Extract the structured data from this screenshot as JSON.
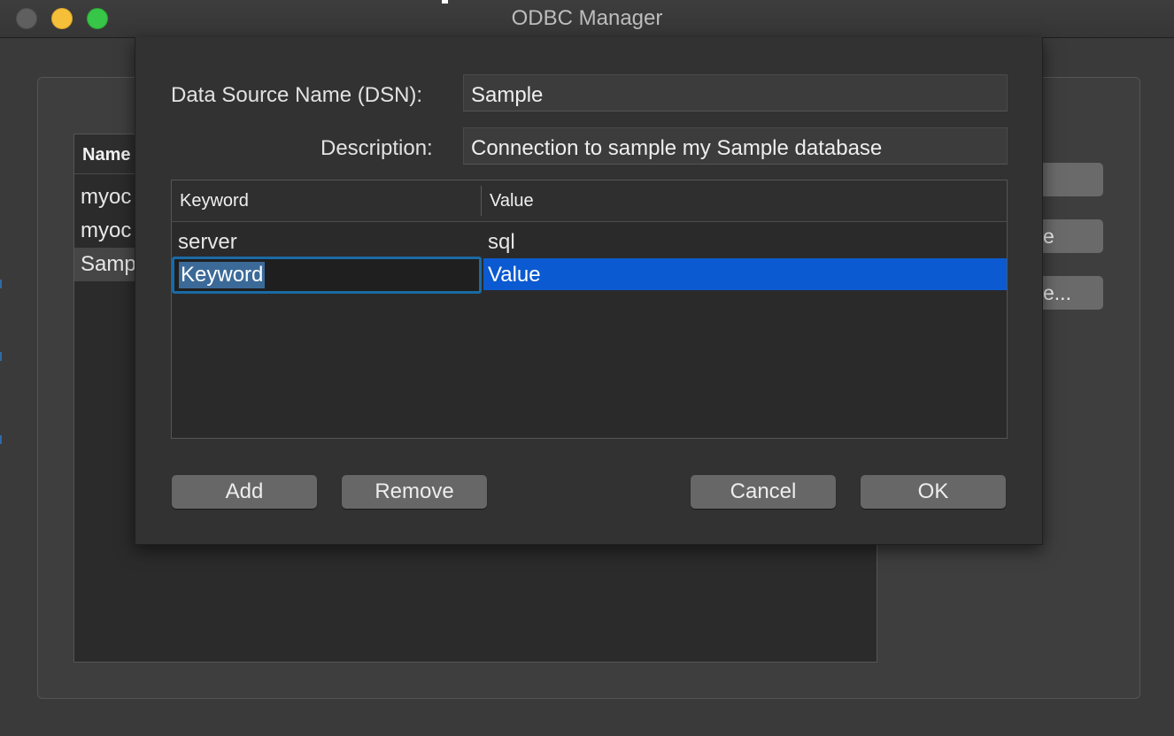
{
  "window": {
    "title": "ODBC Manager"
  },
  "dsn_list": {
    "header": "Name",
    "rows": [
      "myoc",
      "myoc",
      "Samp"
    ],
    "selected_index": 2
  },
  "side_buttons": [
    "",
    "e",
    "e..."
  ],
  "dialog": {
    "dsn_label": "Data Source Name (DSN):",
    "dsn_value": "Sample",
    "description_label": "Description:",
    "description_value": "Connection to sample my Sample database",
    "table": {
      "columns": [
        "Keyword",
        "Value"
      ],
      "rows": [
        {
          "keyword": "server",
          "value": "sql"
        },
        {
          "keyword": "Keyword",
          "value": "Value"
        }
      ],
      "editing_row": 1
    },
    "buttons": {
      "add": "Add",
      "remove": "Remove",
      "cancel": "Cancel",
      "ok": "OK"
    }
  },
  "colors": {
    "selection": "#0b5ad1",
    "focus_ring": "#1a6aa4",
    "traffic_min": "#f5bf3a",
    "traffic_max": "#37c647"
  }
}
